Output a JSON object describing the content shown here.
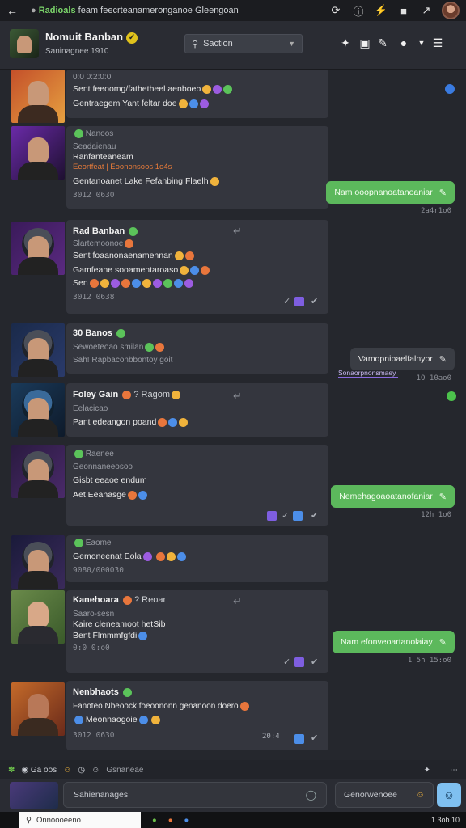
{
  "browser": {
    "url_prefix": "Radioals",
    "url_text": "feam feecrteanameronganoe Gleengoan"
  },
  "header": {
    "name": "Nomuit Banban",
    "sub": "Saninagnee   1910",
    "search_placeholder": "Saction"
  },
  "messages": [
    {
      "line1": "0:0 0:2:0:0",
      "line2": "Sent feeoomg/fathetheel aenboeb",
      "line3": "Gentraegem Yant feltar doe"
    },
    {
      "tag": "Nanoos",
      "line1": "Seadaienau",
      "line2": "Ranfanteaneam",
      "line3": "Eeortfeat | Eoononsoos 1o4s",
      "line4": "Gentanoanet Lake Fefahbing Flaelh",
      "time": "3012 0630"
    },
    {
      "name": "Rad Banban",
      "line1": "Slartemoonoe",
      "line2": "Sent foaanonaenamennan",
      "line3": "Gamfeane sooamentaroaso",
      "line4": "Sen",
      "time": "3012 0638"
    },
    {
      "name": "30 Banos",
      "line1": "Sewoeteoao smilan",
      "line2": "Sah! Rapbaconbbontoy goit"
    },
    {
      "name": "Foley Gain",
      "extra": "? Ragom",
      "line1": "Eelacicao",
      "line2": "Pant edeangon poand"
    },
    {
      "tag": "Raenee",
      "line1": "Geonnaneeosoo",
      "line2": "Gisbt eeaoe endum",
      "line3": "Aet Eeanasge"
    },
    {
      "tag": "Eaome",
      "line1": "Gemoneenat Eola",
      "line2": "9080/000030"
    },
    {
      "name": "Kanehoara",
      "extra": "? Reoar",
      "line1": "Saaro-sesn",
      "line2": "Kaire cleneamoot hetSib",
      "line3": "Bent Flmmmfgfdi",
      "line4": "0:0 0:o0"
    },
    {
      "name": "Nenbhaots",
      "line1": "Fanoteo Nbeoock foeoononn genanoon doero",
      "line2": "Meonnaogoie",
      "time": "3012 0630",
      "right_time": "20:4"
    }
  ],
  "outgoing": [
    {
      "text": "Nam ooopnanoatanoaniar",
      "time": "2a4r1o0"
    },
    {
      "text": "Vamopnipaelfalnyor",
      "time": "1O 10ao0",
      "sub": "Sonaorpnonsmaey"
    },
    {
      "text": "Nemehagoaoatanofaniar",
      "time": "12h 1o0"
    },
    {
      "text": "Nam efonveoartanolaiay",
      "time": "1 5h 15:o0"
    }
  ],
  "toolbar": {
    "label": "Ga oos",
    "channel": "Gsnaneae"
  },
  "composer": {
    "placeholder": "Sahienanages",
    "side_placeholder": "Genorwenoee"
  },
  "taskbar": {
    "search": "Onnoooeeno",
    "clock": "1 3ob 10"
  }
}
